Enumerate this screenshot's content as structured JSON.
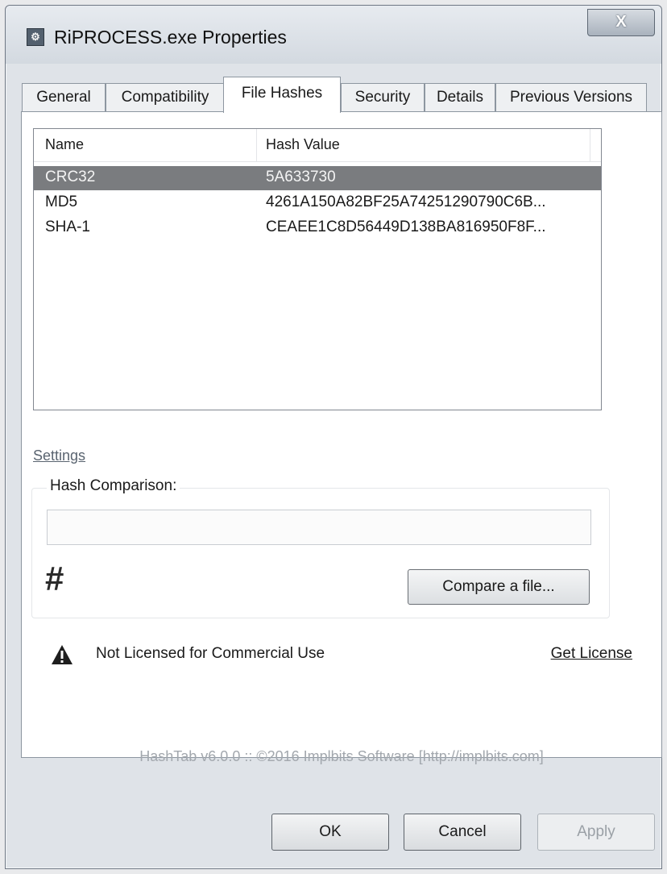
{
  "window": {
    "title": "RiPROCESS.exe Properties",
    "close_glyph": "X"
  },
  "tabs": [
    {
      "label": "General"
    },
    {
      "label": "Compatibility"
    },
    {
      "label": "File Hashes",
      "active": true
    },
    {
      "label": "Security"
    },
    {
      "label": "Details"
    },
    {
      "label": "Previous Versions"
    }
  ],
  "hash_list": {
    "columns": [
      "Name",
      "Hash Value"
    ],
    "rows": [
      {
        "name": "CRC32",
        "value": "5A633730",
        "selected": true
      },
      {
        "name": "MD5",
        "value": "4261A150A82BF25A74251290790C6B..."
      },
      {
        "name": "SHA-1",
        "value": "CEAEE1C8D56449D138BA816950F8F..."
      }
    ]
  },
  "settings_link": "Settings",
  "comparison": {
    "label": "Hash Comparison:",
    "value": "",
    "icon": "hash-icon",
    "compare_button": "Compare a file..."
  },
  "license": {
    "icon": "warning-icon",
    "text": "Not Licensed for Commercial Use",
    "link": "Get License"
  },
  "footer": "HashTab v6.0.0 :: ©2016 Implbits Software [http://implbits.com]",
  "buttons": {
    "ok": "OK",
    "cancel": "Cancel",
    "apply": "Apply"
  },
  "colors": {
    "selection": "#7a7c7f",
    "window_frame": "#dfe3e8",
    "footer_text": "#a3a8ae"
  }
}
